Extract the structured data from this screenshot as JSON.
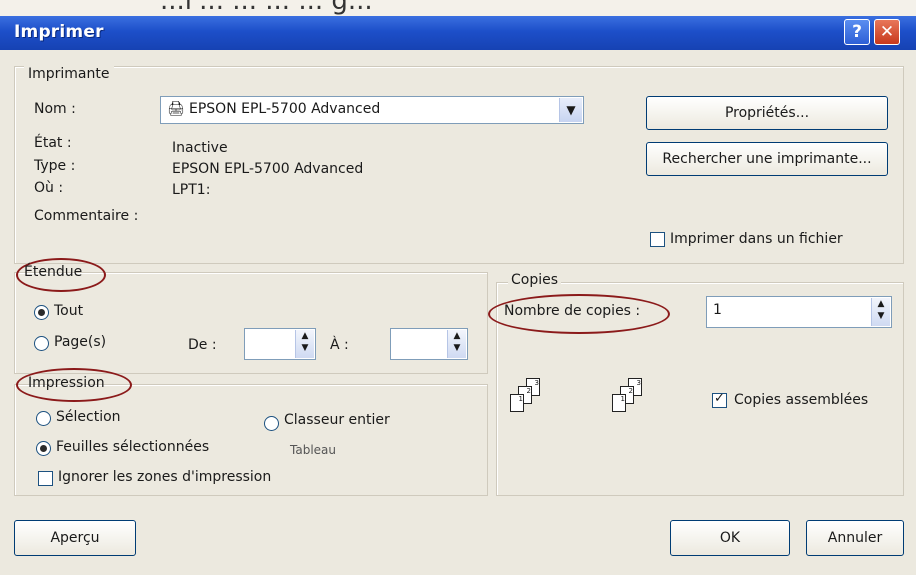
{
  "window": {
    "title": "Imprimer"
  },
  "titlebar": {
    "help_glyph": "?",
    "close_glyph": "✕"
  },
  "printer": {
    "section": "Imprimante",
    "name_label": "Nom :",
    "name_value": "EPSON EPL-5700 Advanced",
    "state_label": "État :",
    "state_value": "Inactive",
    "type_label": "Type :",
    "type_value": "EPSON EPL-5700 Advanced",
    "where_label": "Où :",
    "where_value": "LPT1:",
    "comment_label": "Commentaire :",
    "properties_button": "Propriétés...",
    "find_button": "Rechercher une imprimante...",
    "print_to_file": "Imprimer dans un fichier",
    "print_to_file_checked": false
  },
  "range": {
    "section": "Étendue",
    "all": "Tout",
    "pages": "Page(s)",
    "from_label": "De :",
    "to_label": "À :",
    "selected": "all"
  },
  "print_what": {
    "section": "Impression",
    "selection": "Sélection",
    "whole_workbook": "Classeur entier",
    "active_sheets": "Feuilles sélectionnées",
    "table": "Tableau",
    "ignore_print_areas": "Ignorer les zones d'impression",
    "selected": "active_sheets"
  },
  "copies": {
    "section": "Copies",
    "count_label": "Nombre de copies :",
    "count_value": "1",
    "collate_label": "Copies assemblées",
    "collate_checked": true
  },
  "footer": {
    "preview_button": "Aperçu",
    "ok_button": "OK",
    "cancel_button": "Annuler"
  },
  "background": {
    "top_text": "...l'... ... ... ... g..."
  },
  "colors": {
    "title_bar": "#1d4fc9",
    "annotation": "#8b1a1a",
    "dialog_bg": "#ece9df"
  }
}
